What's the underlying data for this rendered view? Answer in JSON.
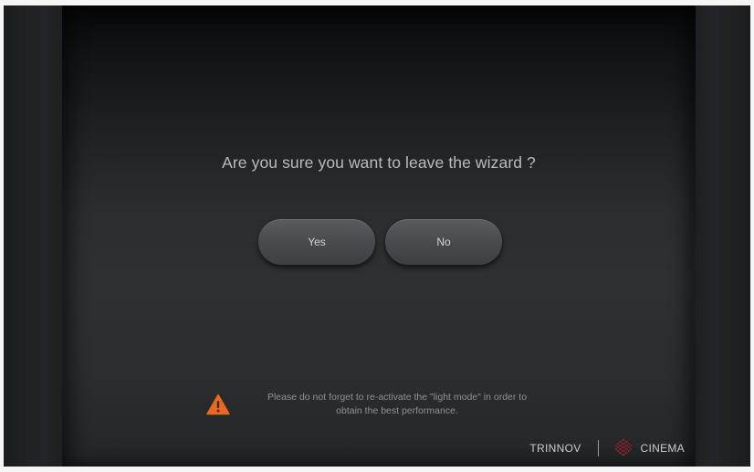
{
  "dialog": {
    "question": "Are you sure you want to leave the wizard ?",
    "yes_label": "Yes",
    "no_label": "No"
  },
  "notice": {
    "line1": "Please do not forget to re-activate the \"light mode\" in order to",
    "line2": "obtain the best performance.",
    "icon": "warning-triangle-icon",
    "icon_color": "#e8691f"
  },
  "brand": {
    "left_text": "TRINNOV",
    "right_text": "CINEMA",
    "logo_icon": "cinema-grid-icon",
    "logo_color": "#7a2230"
  }
}
